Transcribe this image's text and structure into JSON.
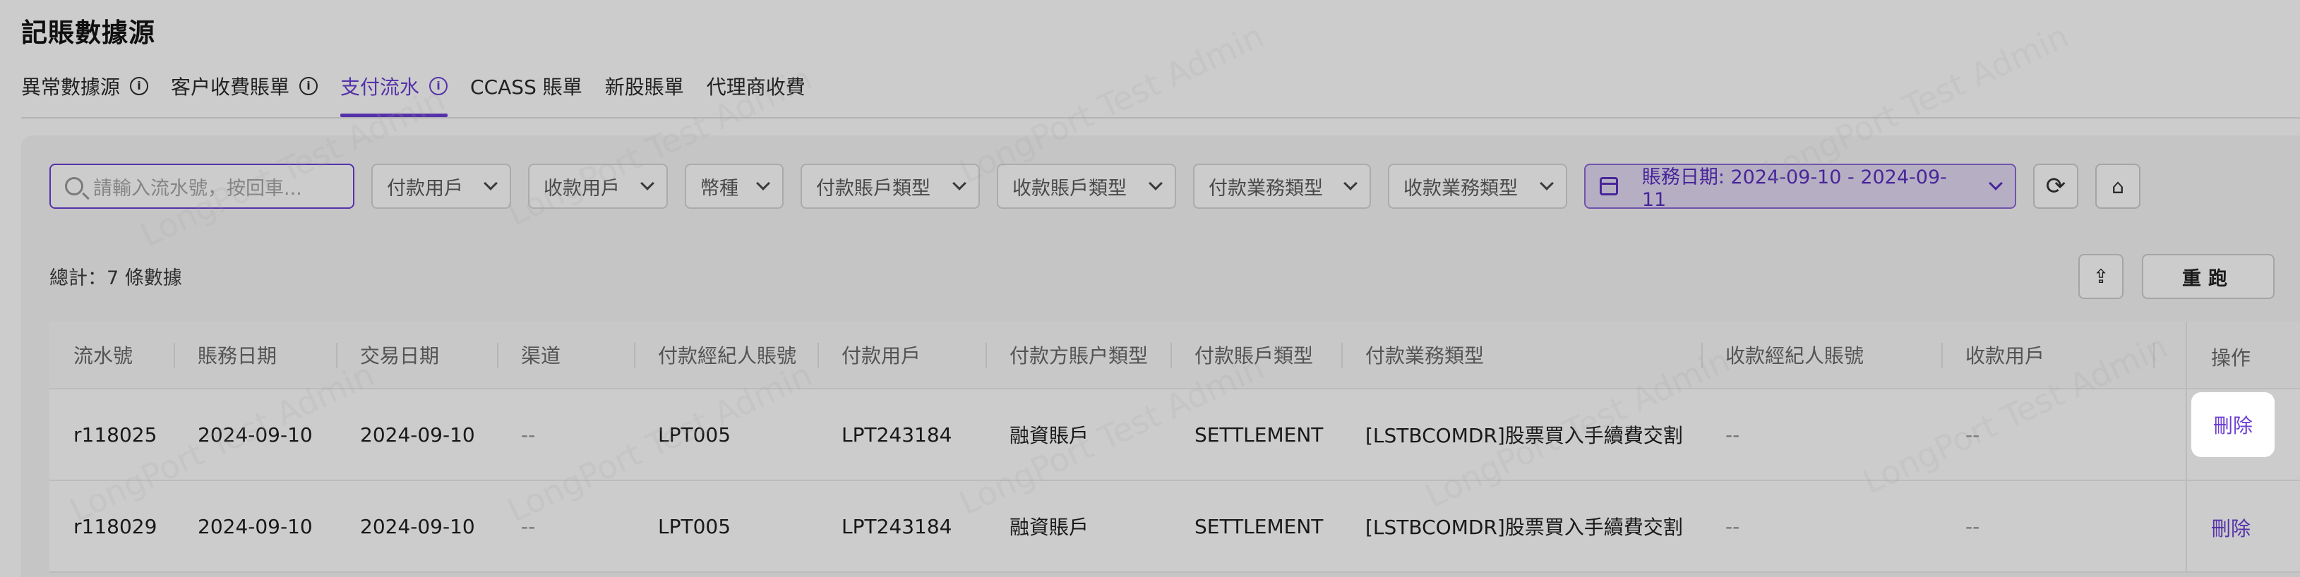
{
  "page": {
    "title": "記賬數據源"
  },
  "tabs": [
    {
      "label": "異常數據源",
      "has_info": true
    },
    {
      "label": "客户收費賬單",
      "has_info": true
    },
    {
      "label": "支付流水",
      "has_info": true,
      "active": true
    },
    {
      "label": "CCASS 賬單",
      "has_info": false
    },
    {
      "label": "新股賬單",
      "has_info": false
    },
    {
      "label": "代理商收費",
      "has_info": false
    }
  ],
  "filters": {
    "search_placeholder": "請輸入流水號，按回車...",
    "payer_user": "付款用戶",
    "payee_user": "收款用戶",
    "currency": "幣種",
    "payer_account_type": "付款賬戶類型",
    "payee_account_type": "收款賬戶類型",
    "payer_business_type": "付款業務類型",
    "payee_business_type": "收款業務類型",
    "date_range": "賬務日期: 2024-09-10 - 2024-09-11"
  },
  "summary": {
    "total_text": "總計：7 條數據"
  },
  "actions": {
    "rerun_label": "重跑"
  },
  "table": {
    "headers": [
      "流水號",
      "賬務日期",
      "交易日期",
      "渠道",
      "付款經紀人賬號",
      "付款用戶",
      "付款方賬户類型",
      "付款賬戶類型",
      "付款業務類型",
      "收款經紀人賬號",
      "收款用戶",
      "操作"
    ],
    "rows": [
      [
        "r118025",
        "2024-09-10",
        "2024-09-10",
        "--",
        "LPT005",
        "LPT243184",
        "融資賬戶",
        "SETTLEMENT",
        "[LSTBCOMDR]股票買入手續費交割",
        "--",
        "--",
        "刪除"
      ],
      [
        "r118029",
        "2024-09-10",
        "2024-09-10",
        "--",
        "LPT005",
        "LPT243184",
        "融資賬戶",
        "SETTLEMENT",
        "[LSTBCOMDR]股票買入手續費交割",
        "--",
        "--",
        "刪除"
      ]
    ]
  },
  "watermark": "LongPort Test Admin",
  "colors": {
    "accent": "#6b3fd4"
  }
}
